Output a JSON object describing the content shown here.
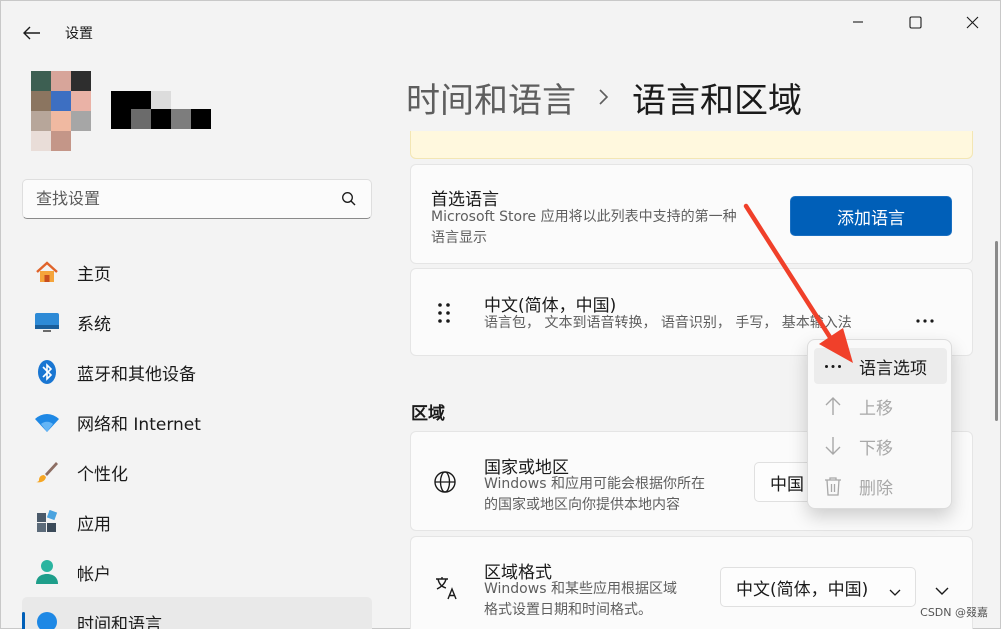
{
  "window": {
    "app_title": "设置"
  },
  "search": {
    "placeholder": "查找设置"
  },
  "sidebar": {
    "items": [
      {
        "label": "主页",
        "icon": "home-icon"
      },
      {
        "label": "系统",
        "icon": "display-icon"
      },
      {
        "label": "蓝牙和其他设备",
        "icon": "bluetooth-icon"
      },
      {
        "label": "网络和 Internet",
        "icon": "wifi-icon"
      },
      {
        "label": "个性化",
        "icon": "brush-icon"
      },
      {
        "label": "应用",
        "icon": "apps-icon"
      },
      {
        "label": "帐户",
        "icon": "account-icon"
      },
      {
        "label": "时间和语言",
        "icon": "globe-clock-icon"
      }
    ]
  },
  "breadcrumb": {
    "parent": "时间和语言",
    "current": "语言和区域"
  },
  "preferred_language": {
    "title": "首选语言",
    "desc_line1": "Microsoft Store 应用将以此列表中支持的第一种",
    "desc_line2": "语言显示",
    "add_button": "添加语言"
  },
  "language_entry": {
    "name": "中文(简体，中国)",
    "features": "语言包， 文本到语音转换， 语音识别， 手写， 基本输入法"
  },
  "region": {
    "section_label": "区域",
    "country": {
      "title": "国家或地区",
      "desc_line1": "Windows 和应用可能会根据你所在",
      "desc_line2": "的国家或地区向你提供本地内容",
      "value": "中国"
    },
    "format": {
      "title": "区域格式",
      "desc_line1": "Windows 和某些应用根据区域",
      "desc_line2": "格式设置日期和时间格式。",
      "value": "中文(简体，中国)"
    }
  },
  "context_menu": {
    "items": [
      {
        "label": "语言选项",
        "enabled": true
      },
      {
        "label": "上移",
        "enabled": false
      },
      {
        "label": "下移",
        "enabled": false
      },
      {
        "label": "删除",
        "enabled": false
      }
    ]
  },
  "watermark": "CSDN @叕嘉",
  "colors": {
    "accent": "#005fb8",
    "annotation_arrow": "#f0402a",
    "notice_background": "#fff8de"
  }
}
